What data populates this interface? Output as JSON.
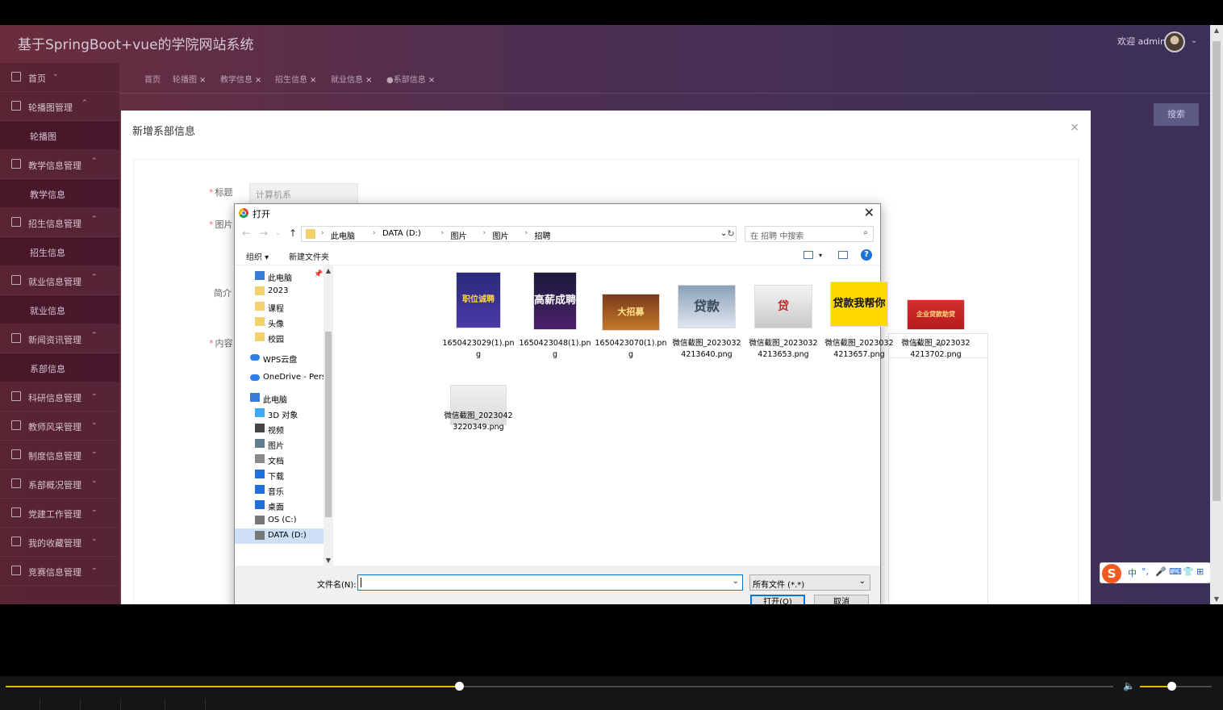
{
  "app": {
    "title": "基于SpringBoot+vue的学院网站系统",
    "welcome": "欢迎 admin"
  },
  "sidebar": {
    "items": [
      {
        "label": "首页",
        "icon": "home-icon",
        "sub": false,
        "arrow": "⌄"
      },
      {
        "label": "轮播图管理",
        "icon": "image-icon",
        "sub": false,
        "arrow": "⌃"
      },
      {
        "label": "轮播图",
        "sub": true
      },
      {
        "label": "教学信息管理",
        "icon": "server-icon",
        "sub": false,
        "arrow": "⌃"
      },
      {
        "label": "教学信息",
        "sub": true
      },
      {
        "label": "招生信息管理",
        "icon": "chart-icon",
        "sub": false,
        "arrow": "⌃"
      },
      {
        "label": "招生信息",
        "sub": true
      },
      {
        "label": "就业信息管理",
        "icon": "image-icon",
        "sub": false,
        "arrow": "⌃"
      },
      {
        "label": "就业信息",
        "sub": true
      },
      {
        "label": "新闻资讯管理",
        "icon": "grid-icon",
        "sub": false,
        "arrow": "⌃"
      },
      {
        "label": "系部信息",
        "sub": true
      },
      {
        "label": "科研信息管理",
        "icon": "bank-icon",
        "sub": false,
        "arrow": "⌄"
      },
      {
        "label": "教师风采管理",
        "icon": "gear-icon",
        "sub": false,
        "arrow": "⌄"
      },
      {
        "label": "制度信息管理",
        "icon": "gear-icon",
        "sub": false,
        "arrow": "⌄"
      },
      {
        "label": "系部概况管理",
        "icon": "server-icon",
        "sub": false,
        "arrow": "⌄"
      },
      {
        "label": "党建工作管理",
        "icon": "grid-icon",
        "sub": false,
        "arrow": "⌄"
      },
      {
        "label": "我的收藏管理",
        "icon": "image-icon",
        "sub": false,
        "arrow": "⌄"
      },
      {
        "label": "竞赛信息管理",
        "icon": "copy-icon",
        "sub": false,
        "arrow": "⌄"
      }
    ]
  },
  "tabs": [
    {
      "label": "首页",
      "closable": false
    },
    {
      "label": "轮播图",
      "closable": true
    },
    {
      "label": "教学信息",
      "closable": true
    },
    {
      "label": "招生信息",
      "closable": true
    },
    {
      "label": "就业信息",
      "closable": true
    },
    {
      "label": "●系部信息",
      "closable": true
    }
  ],
  "background": {
    "search_button": "搜索"
  },
  "modal": {
    "title": "新增系部信息",
    "close": "×",
    "fields": {
      "title_label": "标题",
      "title_value": "计算机系",
      "image_label": "图片",
      "intro_label": "简介",
      "content_label": "内容"
    }
  },
  "dialog": {
    "title": "打开",
    "close": "✕",
    "breadcrumb": [
      "此电脑",
      "DATA (D:)",
      "图片",
      "图片",
      "招聘"
    ],
    "search_placeholder": "在 招聘 中搜索",
    "organize": "组织 ▾",
    "new_folder": "新建文件夹",
    "help": "?",
    "nav_items": [
      {
        "label": "此电脑",
        "icon": "pc-icon",
        "indent": 1
      },
      {
        "label": "2023",
        "icon": "folder-icon",
        "indent": 1
      },
      {
        "label": "课程",
        "icon": "folder-icon",
        "indent": 1
      },
      {
        "label": "头像",
        "icon": "folder-icon",
        "indent": 1
      },
      {
        "label": "校园",
        "icon": "folder-icon",
        "indent": 1
      },
      {
        "label": "WPS云盘",
        "icon": "cloud-icon",
        "indent": 0
      },
      {
        "label": "OneDrive - Perso",
        "icon": "cloud-icon",
        "indent": 0
      },
      {
        "label": "此电脑",
        "icon": "pc-icon",
        "indent": 0
      },
      {
        "label": "3D 对象",
        "icon": "cube-icon",
        "indent": 1
      },
      {
        "label": "视频",
        "icon": "video-icon",
        "indent": 1
      },
      {
        "label": "图片",
        "icon": "picture-icon",
        "indent": 1
      },
      {
        "label": "文档",
        "icon": "document-icon",
        "indent": 1
      },
      {
        "label": "下载",
        "icon": "download-icon",
        "indent": 1
      },
      {
        "label": "音乐",
        "icon": "music-icon",
        "indent": 1
      },
      {
        "label": "桌面",
        "icon": "desktop-icon",
        "indent": 1
      },
      {
        "label": "OS (C:)",
        "icon": "drive-icon",
        "indent": 1
      },
      {
        "label": "DATA (D:)",
        "icon": "drive-icon",
        "indent": 1,
        "selected": true
      }
    ],
    "files": [
      {
        "name": "1650423029(1).png",
        "thumb_text": "职位诚聘"
      },
      {
        "name": "1650423048(1).png",
        "thumb_text": "高薪成聘"
      },
      {
        "name": "1650423070(1).png",
        "thumb_text": "大招募"
      },
      {
        "name": "微信截图_20230324213640.png",
        "thumb_text": "贷款"
      },
      {
        "name": "微信截图_20230324213653.png",
        "thumb_text": "贷"
      },
      {
        "name": "微信截图_20230324213657.png",
        "thumb_text": "贷款我帮你"
      },
      {
        "name": "微信截图_20230324213702.png",
        "thumb_text": "企业贷款助贷"
      },
      {
        "name": "微信截图_20230423220349.png",
        "thumb_text": ""
      }
    ],
    "filename_label": "文件名(N):",
    "filename_value": "",
    "filetype": "所有文件 (*.*)",
    "open_button": "打开(O)",
    "cancel_button": "取消"
  },
  "ime": {
    "logo": "S",
    "glyphs": [
      "中",
      "°,",
      "🎤",
      "⌨",
      "👕",
      "⊞"
    ]
  },
  "player": {
    "progress": 0.409,
    "volume": 0.44
  }
}
